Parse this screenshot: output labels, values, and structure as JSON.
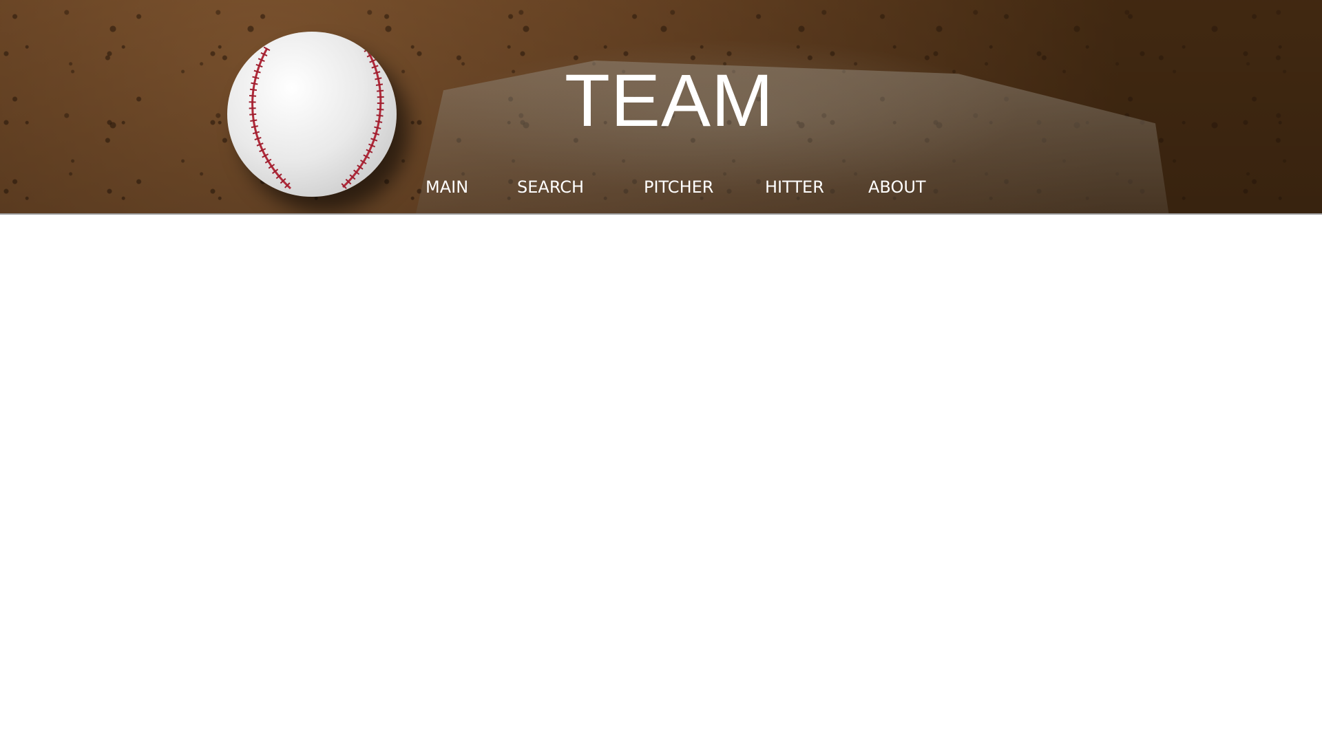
{
  "header": {
    "title": "TEAM",
    "background_image": "baseball-on-home-plate-dirt"
  },
  "nav": {
    "items": [
      {
        "label": "MAIN"
      },
      {
        "label": "SEARCH"
      },
      {
        "label": "PITCHER"
      },
      {
        "label": "HITTER"
      },
      {
        "label": "ABOUT"
      }
    ]
  },
  "colors": {
    "nav_text": "#ffffff",
    "title_text": "#ffffff",
    "page_background": "#ffffff"
  }
}
